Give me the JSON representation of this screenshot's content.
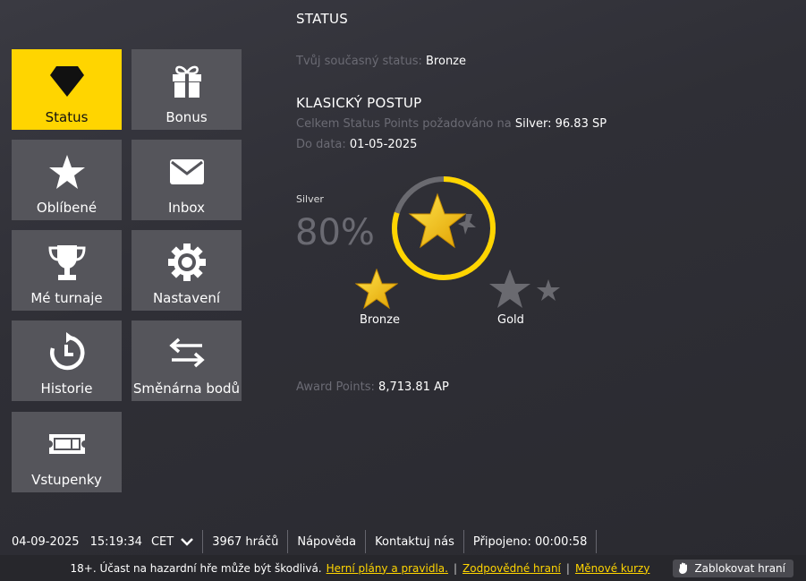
{
  "menu": [
    {
      "id": "status",
      "label": "Status",
      "icon": "diamond-icon"
    },
    {
      "id": "bonus",
      "label": "Bonus",
      "icon": "gift-icon"
    },
    {
      "id": "favorites",
      "label": "Oblíbené",
      "icon": "star-icon"
    },
    {
      "id": "inbox",
      "label": "Inbox",
      "icon": "envelope-icon"
    },
    {
      "id": "tournaments",
      "label": "Mé turnaje",
      "icon": "trophy-icon"
    },
    {
      "id": "settings",
      "label": "Nastavení",
      "icon": "gear-icon"
    },
    {
      "id": "history",
      "label": "Historie",
      "icon": "history-icon"
    },
    {
      "id": "exchange",
      "label": "Směnárna bodů",
      "icon": "exchange-icon"
    },
    {
      "id": "tickets",
      "label": "Vstupenky",
      "icon": "ticket-icon"
    }
  ],
  "colors": {
    "accent": "#ffd500",
    "tile": "#55555b",
    "muted": "#6b6b74"
  },
  "status": {
    "title": "STATUS",
    "current_label": "Tvůj současný status:",
    "current_value": "Bronze",
    "section_title": "KLASICKÝ POSTUP",
    "required_label": "Celkem Status Points požadováno na",
    "required_value": "Silver: 96.83 SP",
    "date_label": "Do data:",
    "date_value": "01-05-2025",
    "tier_label": "Silver",
    "progress_percent": "80%",
    "progress_fraction": 0.8,
    "left_star_label": "Bronze",
    "right_star_label": "Gold",
    "award_label": "Award Points:",
    "award_value": "8,713.81 AP"
  },
  "footer": {
    "date": "04-09-2025",
    "time": "15:19:34",
    "timezone": "CET",
    "players": "3967 hráčů",
    "help": "Nápověda",
    "contact": "Kontaktuj nás",
    "connected": "Připojeno: 00:00:58"
  },
  "legal": {
    "warning": "18+. Účast na hazardní hře může být škodlivá.",
    "link1": "Herní plány a pravidla.",
    "link2": "Zodpovědné hraní",
    "link3": "Měnové kurzy",
    "block_button": "Zablokovat hraní"
  }
}
